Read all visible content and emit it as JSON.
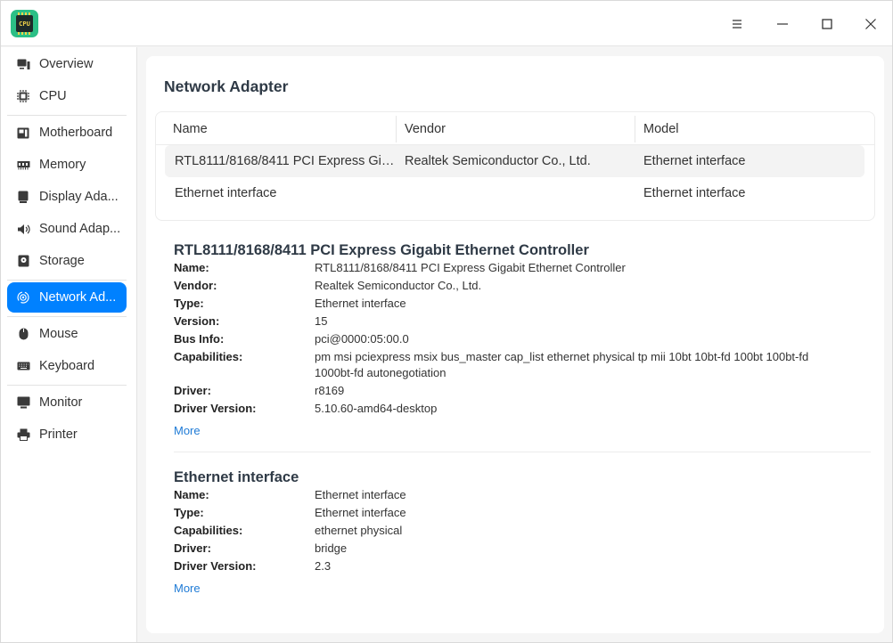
{
  "app": {
    "icon_text": "CPU"
  },
  "window_controls": [
    "menu-icon",
    "minimize-icon",
    "maximize-icon",
    "close-icon"
  ],
  "sidebar": {
    "items": [
      {
        "label": "Overview",
        "icon": "overview-icon"
      },
      {
        "label": "CPU",
        "icon": "cpu-icon"
      },
      {
        "label": "Motherboard",
        "icon": "motherboard-icon"
      },
      {
        "label": "Memory",
        "icon": "memory-icon"
      },
      {
        "label": "Display Ada...",
        "icon": "display-adapter-icon"
      },
      {
        "label": "Sound Adap...",
        "icon": "sound-icon"
      },
      {
        "label": "Storage",
        "icon": "storage-icon"
      },
      {
        "label": "Network Ad...",
        "icon": "network-icon",
        "active": true
      },
      {
        "label": "Mouse",
        "icon": "mouse-icon"
      },
      {
        "label": "Keyboard",
        "icon": "keyboard-icon"
      },
      {
        "label": "Monitor",
        "icon": "monitor-icon"
      },
      {
        "label": "Printer",
        "icon": "printer-icon"
      }
    ],
    "accent": "#0081ff"
  },
  "main": {
    "title": "Network Adapter",
    "table": {
      "columns": [
        "Name",
        "Vendor",
        "Model"
      ],
      "rows": [
        [
          "RTL8111/8168/8411 PCI Express Gig...",
          "Realtek Semiconductor Co., Ltd.",
          "Ethernet interface"
        ],
        [
          "Ethernet interface",
          "",
          "Ethernet interface"
        ]
      ]
    },
    "devices": [
      {
        "title": "RTL8111/8168/8411 PCI Express Gigabit Ethernet Controller",
        "fields": [
          {
            "k": "Name:",
            "v": "RTL8111/8168/8411 PCI Express Gigabit Ethernet Controller"
          },
          {
            "k": "Vendor:",
            "v": "Realtek Semiconductor Co., Ltd."
          },
          {
            "k": "Type:",
            "v": "Ethernet interface"
          },
          {
            "k": "Version:",
            "v": "15"
          },
          {
            "k": "Bus Info:",
            "v": "pci@0000:05:00.0"
          },
          {
            "k": "Capabilities:",
            "v": "pm msi pciexpress msix bus_master cap_list ethernet physical tp mii 10bt 10bt-fd 100bt 100bt-fd 1000bt-fd autonegotiation"
          },
          {
            "k": "Driver:",
            "v": "r8169"
          },
          {
            "k": "Driver Version:",
            "v": "5.10.60-amd64-desktop"
          }
        ],
        "more": "More"
      },
      {
        "title": "Ethernet interface",
        "fields": [
          {
            "k": "Name:",
            "v": "Ethernet interface"
          },
          {
            "k": "Type:",
            "v": "Ethernet interface"
          },
          {
            "k": "Capabilities:",
            "v": "ethernet physical"
          },
          {
            "k": "Driver:",
            "v": "bridge"
          },
          {
            "k": "Driver Version:",
            "v": "2.3"
          }
        ],
        "more": "More"
      }
    ]
  }
}
